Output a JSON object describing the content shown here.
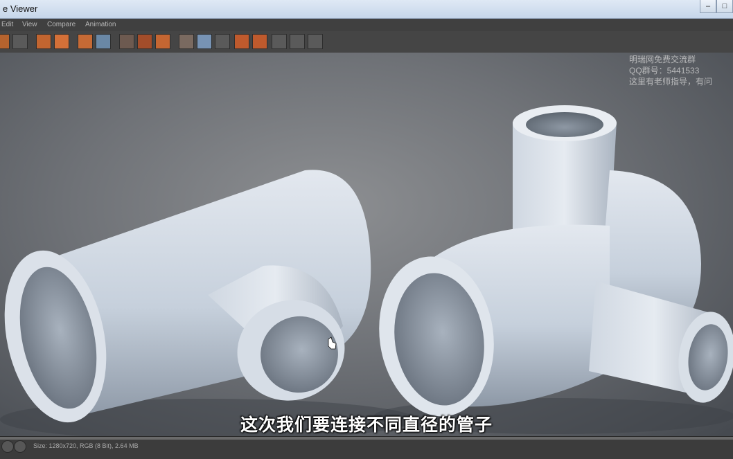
{
  "window": {
    "title": "e Viewer"
  },
  "menu": {
    "items": [
      "Edit",
      "View",
      "Compare",
      "Animation"
    ]
  },
  "toolbar": {
    "groups": [
      [
        "show-icon",
        "frame-icon"
      ],
      [
        "render-region-icon",
        "user-icon"
      ],
      [
        "copy-icon",
        "paste-icon"
      ],
      [
        "region-a-icon",
        "region-b-icon",
        "settings-icon"
      ],
      [
        "compare-icon",
        "split-icon",
        "ab-icon"
      ],
      [
        "a-marker-icon",
        "b-marker-icon"
      ],
      [
        "layout-1-icon",
        "layout-2-icon",
        "layout-3-icon"
      ]
    ]
  },
  "watermark": {
    "line1": "明瑞网免费交流群",
    "line2": "QQ群号：5441533",
    "line3": "这里有老师指导，有问"
  },
  "subtitle": "这次我们要连接不同直径的管子",
  "status": {
    "text": "Size: 1280x720, RGB (8 Bit), 2.64 MB"
  },
  "colors": {
    "accent": "#d4622a",
    "pipe": "#c9d3df",
    "background": "#6f7277"
  }
}
